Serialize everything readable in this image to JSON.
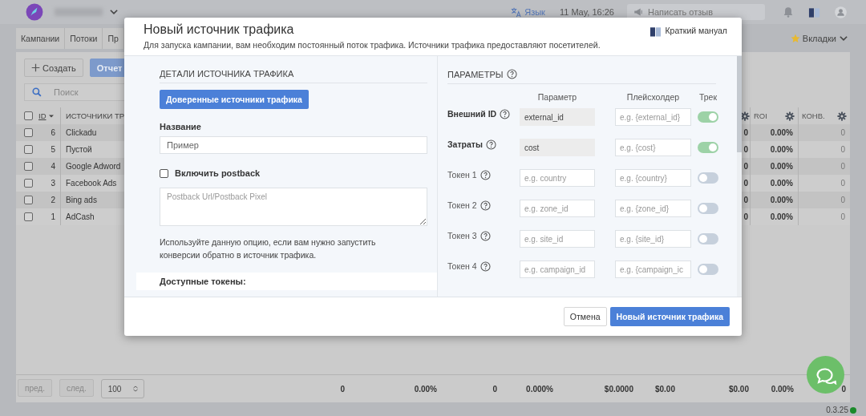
{
  "topbar": {
    "language": "Язык",
    "datetime": "11 May, 16:26",
    "feedback": {
      "placeholder": "Написать отзыв"
    }
  },
  "nav_tabs": [
    "Кампании",
    "Потоки",
    "Пр"
  ],
  "tabs_menu": "Вкладки",
  "toolbar": {
    "create": "Создать",
    "report": "Отчет",
    "search": {
      "placeholder": "Поиск"
    }
  },
  "table": {
    "select_all": {
      "checked": false
    },
    "columns": [
      "ID",
      "ИСТОЧНИКИ ТР",
      "ROI",
      "КОНВ."
    ],
    "rows": [
      {
        "checked": false,
        "id": "6",
        "name": "Clickadu",
        "column_3": "0",
        "roi": "0.00%",
        "conversions": "0"
      },
      {
        "checked": false,
        "id": "5",
        "name": "Пустой",
        "column_3": "0",
        "roi": "0.00%",
        "conversions": "0"
      },
      {
        "checked": false,
        "id": "4",
        "name": "Google Adword",
        "column_3": "0",
        "roi": "0.00%",
        "conversions": "0"
      },
      {
        "checked": false,
        "id": "3",
        "name": "Facebook Ads",
        "column_3": "0",
        "roi": "0.00%",
        "conversions": "0"
      },
      {
        "checked": false,
        "id": "2",
        "name": "Bing ads",
        "column_3": "0",
        "roi": "0.00%",
        "conversions": "0"
      },
      {
        "checked": false,
        "id": "1",
        "name": "AdCash",
        "column_3": "0",
        "roi": "0.00%",
        "conversions": "0"
      }
    ],
    "totals": [
      "0",
      "0.00%",
      "0",
      "0.000%",
      "$0.0000",
      "$0.00",
      "$0.00",
      "0.00%",
      "0"
    ]
  },
  "pagination": {
    "prev": "пред.",
    "next": "след.",
    "page_size": "100"
  },
  "version": "0.3.25",
  "modal": {
    "title": "Новый источник трафика",
    "subtitle": "Для запуска кампании, вам необходим постоянный поток трафика. Источники трафика предоставляют посетителей.",
    "manual_link": "Краткий мануал",
    "details": {
      "heading": "ДЕТАЛИ ИСТОЧНИКА ТРАФИКА",
      "trusted_button": "Доверенные источники трафика",
      "name_label": "Название",
      "name_field": {
        "placeholder": "Пример"
      },
      "postback": {
        "label": "Включить postback",
        "checked": false
      },
      "postback_field": {
        "placeholder": "Postback Url/Postback Pixel"
      },
      "help": "Используйте данную опцию, если вам нужно запустить конверсии обратно в источник трафика.",
      "tokens_heading": "Доступные токены:"
    },
    "params": {
      "heading": "ПАРАМЕТРЫ",
      "columns": [
        "Параметр",
        "Плейсхолдер",
        "Трек"
      ],
      "rows": [
        {
          "kind": "fixed",
          "label": "Внешний ID",
          "parameter_field": {
            "value": "external_id"
          },
          "placeholder_field": {
            "placeholder": "e.g. {external_id}"
          },
          "on": true
        },
        {
          "kind": "fixed",
          "label": "Затраты",
          "parameter_field": {
            "value": "cost"
          },
          "placeholder_field": {
            "placeholder": "e.g. {cost}"
          },
          "on": true
        },
        {
          "kind": "token",
          "label": "Токен 1",
          "parameter_field": {
            "placeholder": "e.g. country"
          },
          "placeholder_field": {
            "placeholder": "e.g. {country}"
          },
          "on": false
        },
        {
          "kind": "token",
          "label": "Токен 2",
          "parameter_field": {
            "placeholder": "e.g. zone_id"
          },
          "placeholder_field": {
            "placeholder": "e.g. {zone_id}"
          },
          "on": false
        },
        {
          "kind": "token",
          "label": "Токен 3",
          "parameter_field": {
            "placeholder": "e.g. site_id"
          },
          "placeholder_field": {
            "placeholder": "e.g. {site_id}"
          },
          "on": false
        },
        {
          "kind": "token",
          "label": "Токен 4",
          "parameter_field": {
            "placeholder": "e.g. campaign_id"
          },
          "placeholder_field": {
            "placeholder": "e.g. {campaign_ic"
          },
          "on": false
        }
      ]
    },
    "cancel": "Отмена",
    "submit": "Новый источник трафика"
  }
}
